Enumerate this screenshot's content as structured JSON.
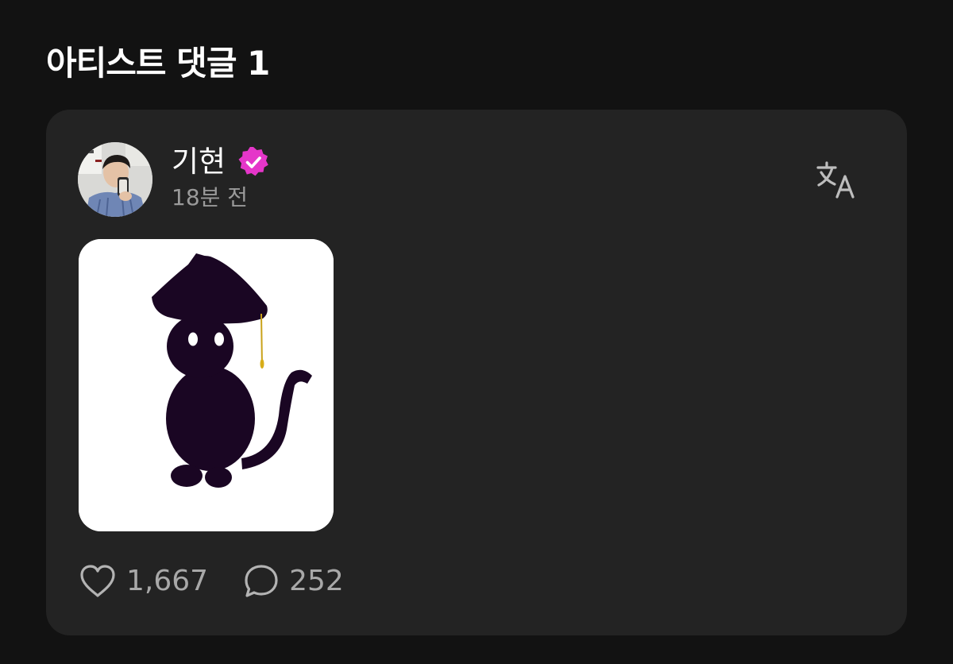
{
  "section": {
    "title": "아티스트 댓글 1"
  },
  "comment": {
    "author": "기현",
    "verified": true,
    "timestamp": "18분 전",
    "likes": "1,667",
    "replies": "252",
    "icons": {
      "avatar": "profile-photo",
      "verified": "verified-badge-icon",
      "translate": "translate-icon",
      "like": "heart-icon",
      "reply": "speech-bubble-icon"
    },
    "attachment": {
      "description_icon": "drawing-image"
    }
  },
  "colors": {
    "background": "#121212",
    "card": "#232323",
    "badge": "#e536c9",
    "muted_text": "#9a9a9a"
  }
}
